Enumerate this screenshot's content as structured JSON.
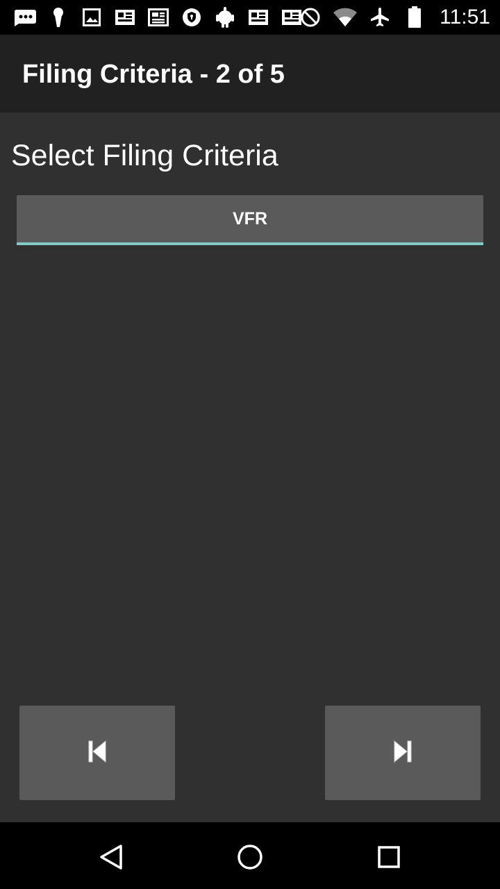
{
  "status_bar": {
    "time": "11:51",
    "left_icons": [
      "messaging-icon",
      "keyhole-icon",
      "image-icon",
      "news-icon",
      "article-icon",
      "shield-icon",
      "android-icon",
      "news-icon",
      "news-icon"
    ],
    "right_icons": [
      "do-not-disturb-icon",
      "wifi-icon",
      "airplane-mode-icon",
      "battery-icon"
    ]
  },
  "action_bar": {
    "title": "Filing Criteria - 2 of 5"
  },
  "content": {
    "heading": "Select Filing Criteria",
    "criteria_button_label": "VFR"
  },
  "navigation": {
    "previous_icon": "skip-previous-icon",
    "next_icon": "skip-next-icon"
  },
  "system_nav": {
    "back_icon": "back-icon",
    "home_icon": "home-icon",
    "recents_icon": "recents-icon"
  },
  "colors": {
    "background": "#303030",
    "action_bar": "#212121",
    "button": "#5a5a5b",
    "accent_underline": "#80cbc4"
  }
}
